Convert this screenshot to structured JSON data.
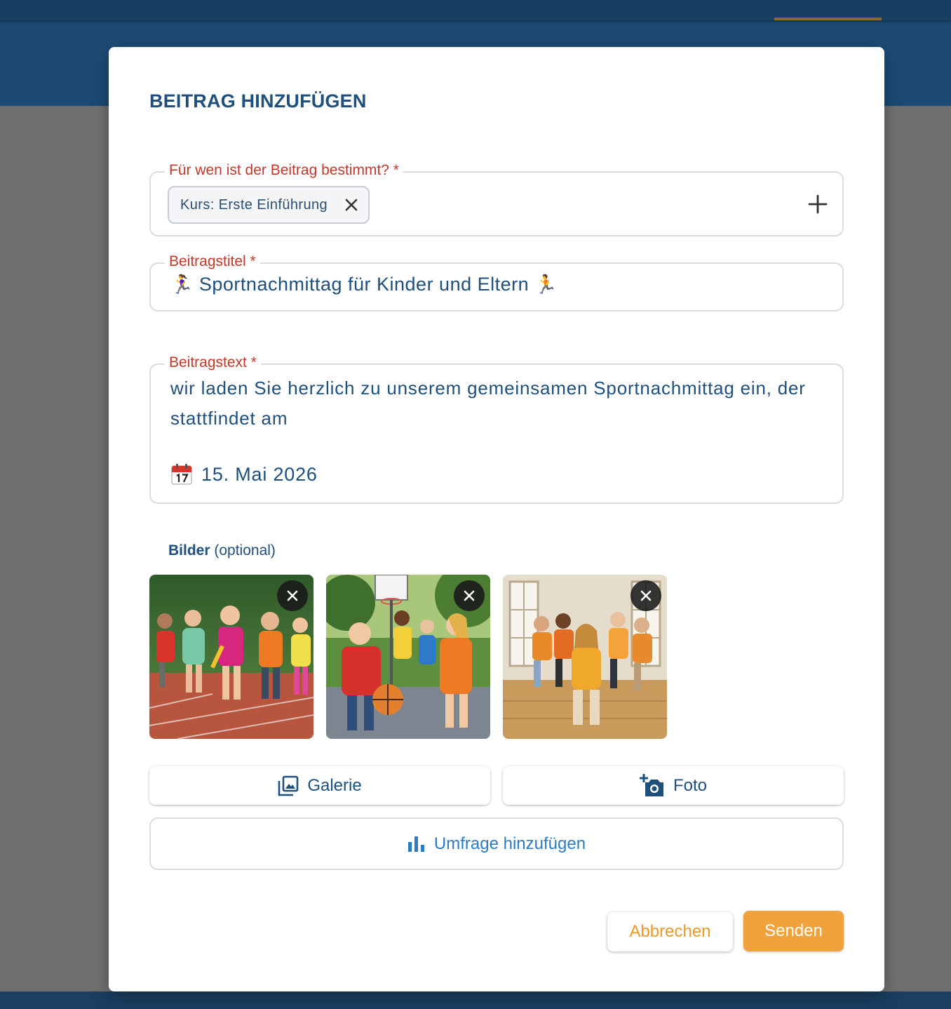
{
  "dialog": {
    "title": "BEITRAG HINZUFÜGEN"
  },
  "recipients": {
    "label": "Für wen ist der Beitrag bestimmt? *",
    "chips": [
      {
        "label": "Kurs: Erste Einführung"
      }
    ],
    "add_icon": "plus-icon",
    "remove_icon": "close-icon"
  },
  "post_title": {
    "label": "Beitragstitel *",
    "value_prefix_emoji": "🏃‍♀️",
    "value": "Sportnachmittag für Kinder und Eltern",
    "value_suffix_emoji": "🏃"
  },
  "post_text": {
    "label": "Beitragstext *",
    "lines": "wir laden Sie herzlich zu unserem gemeinsamen Sportnachmittag ein, der stattfindet am",
    "date_icon": "calendar-icon",
    "date": "15. Mai 2026"
  },
  "images": {
    "label": "Bilder",
    "label_suffix": "(optional)",
    "items": [
      {
        "name": "image-running-children",
        "remove_icon": "close-icon"
      },
      {
        "name": "image-basketball-children",
        "remove_icon": "close-icon"
      },
      {
        "name": "image-dancing-group",
        "remove_icon": "close-icon"
      }
    ]
  },
  "actions": {
    "gallery_label": "Galerie",
    "gallery_icon": "gallery-icon",
    "photo_label": "Foto",
    "photo_icon": "add-camera-icon",
    "poll_label": "Umfrage hinzufügen",
    "poll_icon": "bar-chart-icon",
    "cancel_label": "Abbrechen",
    "send_label": "Senden"
  },
  "colors": {
    "primary": "#1f4f7c",
    "header": "#1c4a73",
    "required_label": "#c0392b",
    "accent": "#f0a23c",
    "poll": "#2e7bbf"
  }
}
